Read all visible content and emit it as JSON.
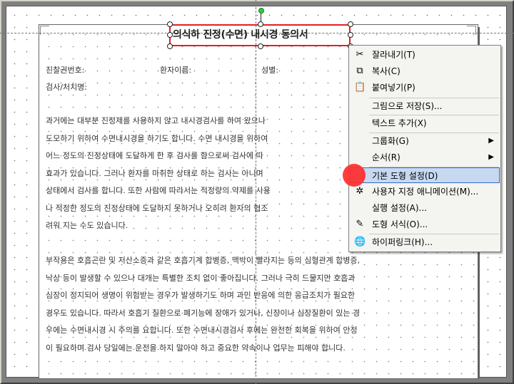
{
  "document": {
    "title": "의식하 진정(수면) 내시경 동의서",
    "fields": {
      "chart_no": "진찰권번호:",
      "patient_name": "환자이름:",
      "sex": "성별:",
      "exam": "검사/처치명:"
    },
    "paragraph1": [
      "과거에는 대부분 진정제를 사용하지 않고 내시경검사를 하여 왔으나",
      "도모하기 위하여 수면내시경을 하기도 합니다. 수면 내시경을 위하여",
      "어느 정도의 진정상태에 도달하게 한 후 검사를 함으로써 검사에 따",
      "효과가 있습니다. 그러나 환자를 마취한 상태로 하는 검사는 아니며",
      "상태에서 검사를 합니다. 또한 사람에 따라서는 적정량의 약제를 사용",
      "나 적정한 정도의 진정상태에 도달하지 못하거나 오히려 환자의 협조",
      "려워 지는 수도 있습니다."
    ],
    "paragraph2": [
      "부작용은 호흡곤란 및 저산소증과 같은 호흡기계 합병증, 맥박이 빨라지는 등의 심혈관계 합병증,",
      "낙상 등이 발생할 수 있으나 대개는 특별한 조치 없이 좋아집니다. 그러나 극히 드물지만 호흡과",
      "심장이 정지되어 생명이 위험받는 경우가 발생하기도 하며 과민 반응에 의한 응급조치가 필요한",
      "경우도 있습니다. 따라서 호흡기 질환으로 폐기능에 장애가 있거나, 신장이나 심장질환이 있는 경",
      "우에는 수면내시경 시 주의를 요합니다. 또한 수면내시경검사 후에는 완전한 회복을 위하여 안정",
      "이 필요하며 검사 당일에는 운전을 하지 말아야 하고 중요한 약속이나 업무는 피해야 합니다."
    ]
  },
  "context_menu": {
    "items": [
      {
        "label": "잘라내기(T)",
        "icon": "scissors-icon",
        "glyph": "✂"
      },
      {
        "label": "복사(C)",
        "icon": "copy-icon",
        "glyph": "⧉"
      },
      {
        "label": "붙여넣기(P)",
        "icon": "paste-icon",
        "glyph": "📋"
      },
      {
        "label": "그림으로 저장(S)...",
        "icon": "",
        "glyph": ""
      },
      {
        "label": "텍스트 추가(X)",
        "icon": "",
        "glyph": ""
      },
      {
        "label": "그룹화(G)",
        "icon": "",
        "glyph": "",
        "submenu": "▶"
      },
      {
        "label": "순서(R)",
        "icon": "",
        "glyph": "",
        "submenu": "▶"
      },
      {
        "label": "기본 도형 설정(D)",
        "icon": "",
        "glyph": "",
        "highlighted": true
      },
      {
        "label": "사용자 지정 애니메이션(M)...",
        "icon": "custom-animation-icon",
        "glyph": "✲"
      },
      {
        "label": "실행 설정(A)...",
        "icon": "",
        "glyph": ""
      },
      {
        "label": "도형 서식(O)...",
        "icon": "format-shape-icon",
        "glyph": "✎"
      },
      {
        "label": "하이퍼링크(H)...",
        "icon": "hyperlink-icon",
        "glyph": "🌐"
      }
    ]
  },
  "colors": {
    "selection_border": "#e02020",
    "menu_highlight": "#c7d9f1",
    "cursor_marker": "#ff2d2d"
  }
}
